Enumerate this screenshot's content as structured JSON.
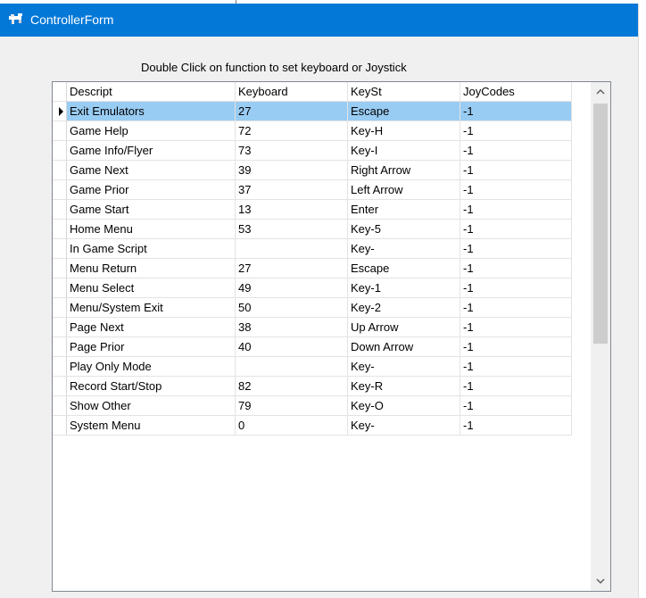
{
  "window": {
    "title": "ControllerForm"
  },
  "instruction": "Double Click on function to set keyboard or Joystick",
  "table": {
    "columns": [
      "Descript",
      "Keyboard",
      "KeySt",
      "JoyCodes"
    ],
    "rows": [
      {
        "descript": "Exit Emulators",
        "keyboard": "27",
        "keyst": "Escape",
        "joycodes": "-1"
      },
      {
        "descript": "Game Help",
        "keyboard": "72",
        "keyst": "Key-H",
        "joycodes": "-1"
      },
      {
        "descript": "Game Info/Flyer",
        "keyboard": "73",
        "keyst": "Key-I",
        "joycodes": "-1"
      },
      {
        "descript": "Game Next",
        "keyboard": "39",
        "keyst": "Right Arrow",
        "joycodes": "-1"
      },
      {
        "descript": "Game Prior",
        "keyboard": "37",
        "keyst": "Left Arrow",
        "joycodes": "-1"
      },
      {
        "descript": "Game Start",
        "keyboard": "13",
        "keyst": "Enter",
        "joycodes": "-1"
      },
      {
        "descript": "Home Menu",
        "keyboard": "53",
        "keyst": "Key-5",
        "joycodes": "-1"
      },
      {
        "descript": "In Game Script",
        "keyboard": "",
        "keyst": "Key-",
        "joycodes": "-1"
      },
      {
        "descript": "Menu Return",
        "keyboard": "27",
        "keyst": "Escape",
        "joycodes": "-1"
      },
      {
        "descript": "Menu Select",
        "keyboard": "49",
        "keyst": "Key-1",
        "joycodes": "-1"
      },
      {
        "descript": "Menu/System Exit",
        "keyboard": "50",
        "keyst": "Key-2",
        "joycodes": "-1"
      },
      {
        "descript": "Page Next",
        "keyboard": "38",
        "keyst": "Up Arrow",
        "joycodes": "-1"
      },
      {
        "descript": "Page Prior",
        "keyboard": "40",
        "keyst": "Down Arrow",
        "joycodes": "-1"
      },
      {
        "descript": "Play Only Mode",
        "keyboard": "",
        "keyst": "Key-",
        "joycodes": "-1"
      },
      {
        "descript": "Record Start/Stop",
        "keyboard": "82",
        "keyst": "Key-R",
        "joycodes": "-1"
      },
      {
        "descript": "Show Other",
        "keyboard": "79",
        "keyst": "Key-O",
        "joycodes": "-1"
      },
      {
        "descript": "System Menu",
        "keyboard": "0",
        "keyst": "Key-",
        "joycodes": "-1"
      }
    ],
    "selected_row": 0
  },
  "icons": {
    "window_icon": "controller-app-icon",
    "current_row": "current-row-arrow-icon",
    "scroll_up": "chevron-up-icon",
    "scroll_down": "chevron-down-icon"
  },
  "colors": {
    "titlebar": "#0478d7",
    "selection": "#99ccf3",
    "window_bg": "#f0f0f0"
  }
}
